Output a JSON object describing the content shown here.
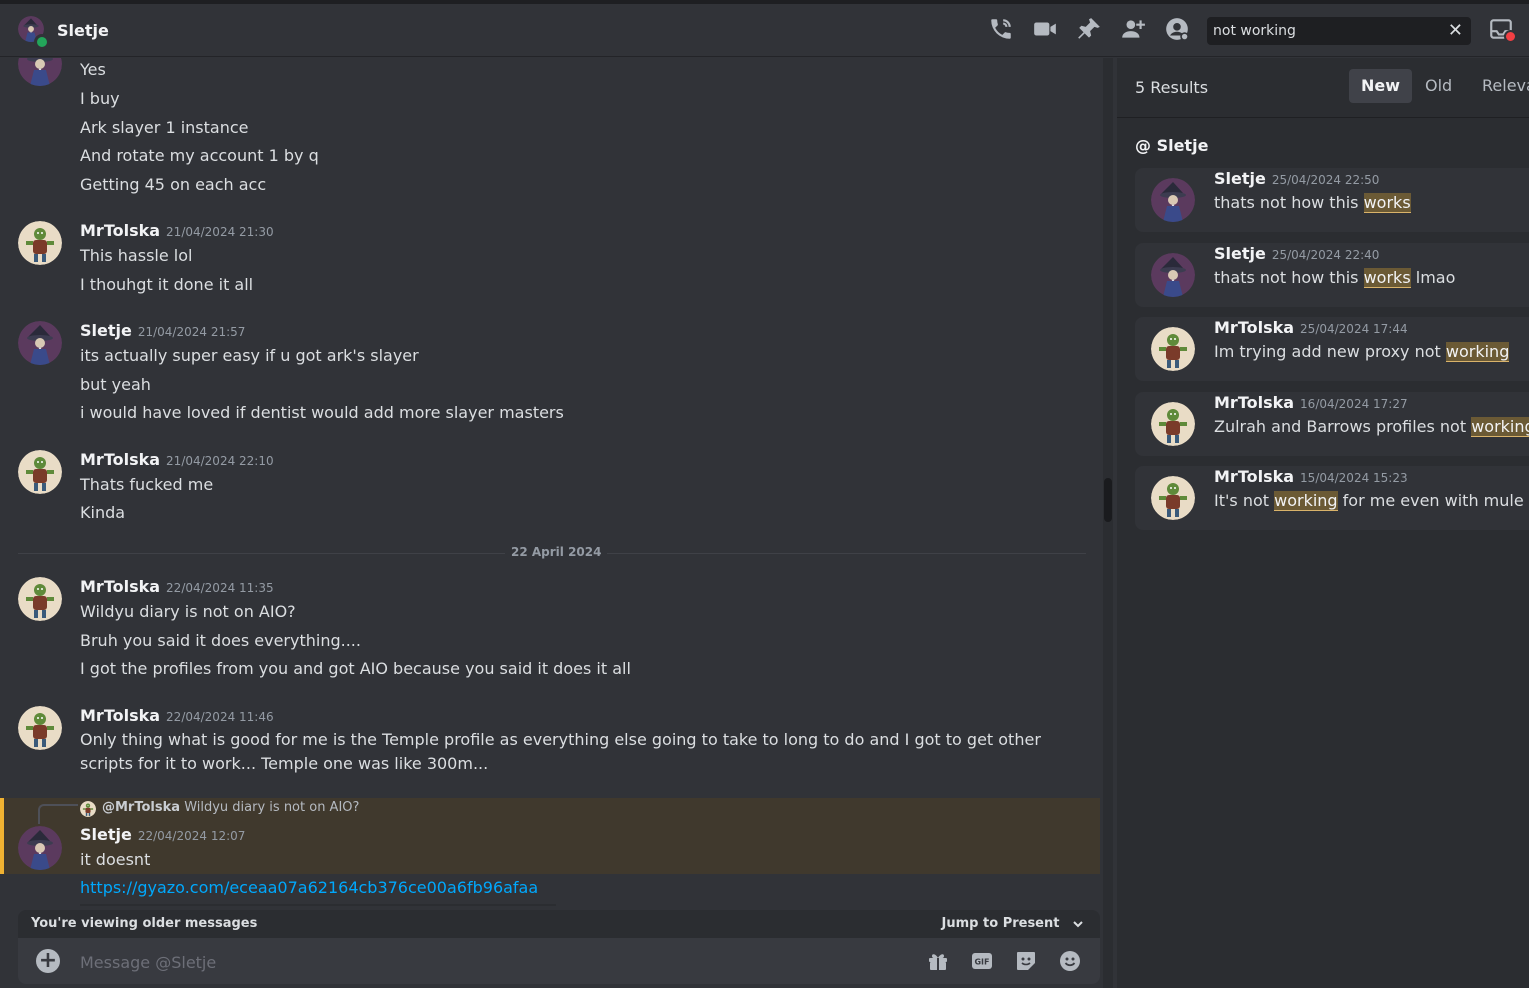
{
  "header": {
    "channel_name": "Sletje",
    "search_value": "not working",
    "search_clear": "✕"
  },
  "messages": [
    {
      "lines": [
        "Yes",
        "I buy",
        "Ark slayer 1 instance",
        "And rotate my account 1 by q",
        "Getting 45 on each acc"
      ]
    },
    {
      "author": "MrTolska",
      "timestamp": "21/04/2024 21:30",
      "lines": [
        "This hassle lol",
        "I thouhgt it done it all"
      ]
    },
    {
      "author": "Sletje",
      "timestamp": "21/04/2024 21:57",
      "lines": [
        "its actually super easy if u got ark's slayer",
        "but yeah",
        "i would have loved if dentist would add more slayer masters"
      ]
    },
    {
      "author": "MrTolska",
      "timestamp": "21/04/2024 22:10",
      "lines": [
        "Thats fucked me",
        "Kinda"
      ]
    },
    {
      "author": "MrTolska",
      "timestamp": "22/04/2024 11:35",
      "lines": [
        "Wildyu diary is not on AIO?",
        "Bruh you said it does everything....",
        "I got the profiles from you and got AIO because you said it does it all"
      ]
    },
    {
      "author": "MrTolska",
      "timestamp": "22/04/2024 11:46",
      "lines": [
        "Only thing what is good for me is the Temple profile as everything else going to take to long to do and I got to get other scripts for it to work... Temple one was like 300m..."
      ]
    },
    {
      "author": "Sletje",
      "timestamp": "22/04/2024 12:07",
      "lines": [
        "it doesnt"
      ],
      "link": "https://gyazo.com/eceaa07a62164cb376ce00a6fb96afaa",
      "reply": {
        "name": "@MrTolska",
        "text": "Wildyu diary is not on AIO?"
      }
    }
  ],
  "date_divider": "22 April 2024",
  "older_bar": {
    "text": "You're viewing older messages",
    "jump": "Jump to Present"
  },
  "composer": {
    "placeholder": "Message @Sletje",
    "plus": "+"
  },
  "search_panel": {
    "results_count": "5 Results",
    "tabs": [
      "New",
      "Old",
      "Relevant"
    ],
    "active_tab": "New",
    "channel": "@ Sletje",
    "results": [
      {
        "author": "Sletje",
        "timestamp": "25/04/2024 22:50",
        "before": "thats not how this ",
        "match": "works",
        "after": ""
      },
      {
        "author": "Sletje",
        "timestamp": "25/04/2024 22:40",
        "before": "thats not how this ",
        "match": "works",
        "after": " lmao"
      },
      {
        "author": "MrTolska",
        "timestamp": "25/04/2024 17:44",
        "before": "Im trying add new proxy not ",
        "match": "working",
        "after": ""
      },
      {
        "author": "MrTolska",
        "timestamp": "16/04/2024 17:27",
        "before": "Zulrah and Barrows profiles not ",
        "match": "working",
        "after": ""
      },
      {
        "author": "MrTolska",
        "timestamp": "15/04/2024 15:23",
        "before": "It's not ",
        "match": "working",
        "after": " for me even with mule on?"
      }
    ]
  },
  "colors": {
    "background": "#313338",
    "panel": "#2b2d31",
    "link": "#00a8fc",
    "online": "#23a55a",
    "highlight_bar": "#f0b232"
  },
  "icons": [
    "phone-call-icon",
    "video-camera-icon",
    "pin-icon",
    "add-friend-icon",
    "user-profile-icon",
    "inbox-icon",
    "gift-icon",
    "gif-icon",
    "sticker-icon",
    "emoji-icon"
  ]
}
